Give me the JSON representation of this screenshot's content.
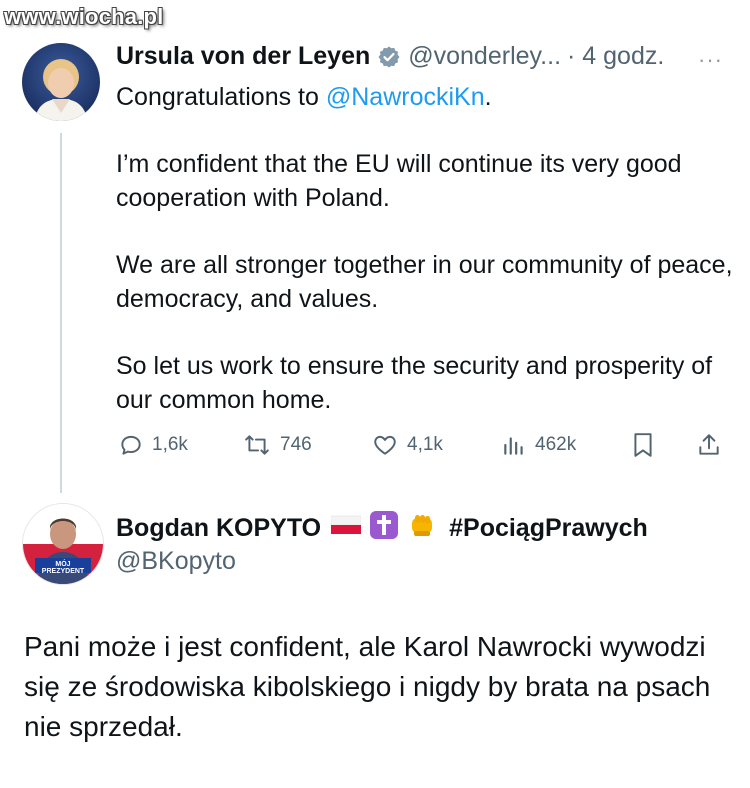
{
  "watermark": "www.wiocha.pl",
  "tweet1": {
    "author_name": "Ursula von der Leyen",
    "verified_icon": "verified-badge-icon",
    "handle": "@vonderley...",
    "time": "· 4 godz.",
    "more_label": "···",
    "line1_prefix": "Congratulations to ",
    "line1_mention": "@NawrockiKn",
    "line1_suffix": ".",
    "para2": "I’m confident that the EU will continue its very good cooperation with Poland.",
    "para3": "We are all stronger together in our community of peace, democracy, and values.",
    "para4": "So let us work to ensure the security and prosperity of our common home.",
    "replies": "1,6k",
    "reposts": "746",
    "likes": "4,1k",
    "views": "462k"
  },
  "tweet2": {
    "author_name": "Bogdan KOPYTO",
    "emojis": [
      "flag-poland-icon",
      "latin-cross-icon",
      "fist-icon"
    ],
    "hashtag": "#PociągPrawych",
    "handle": "@BKopyto",
    "avatar_text": "MÓJ PREZYDENT",
    "body": "Pani może i jest confident, ale Karol Nawrocki wywodzi się ze środowiska kibolskiego i nigdy by brata na psach nie sprzedał."
  },
  "colors": {
    "link": "#1d9bf0",
    "muted": "#536471",
    "thread_line": "#cfd9de"
  }
}
